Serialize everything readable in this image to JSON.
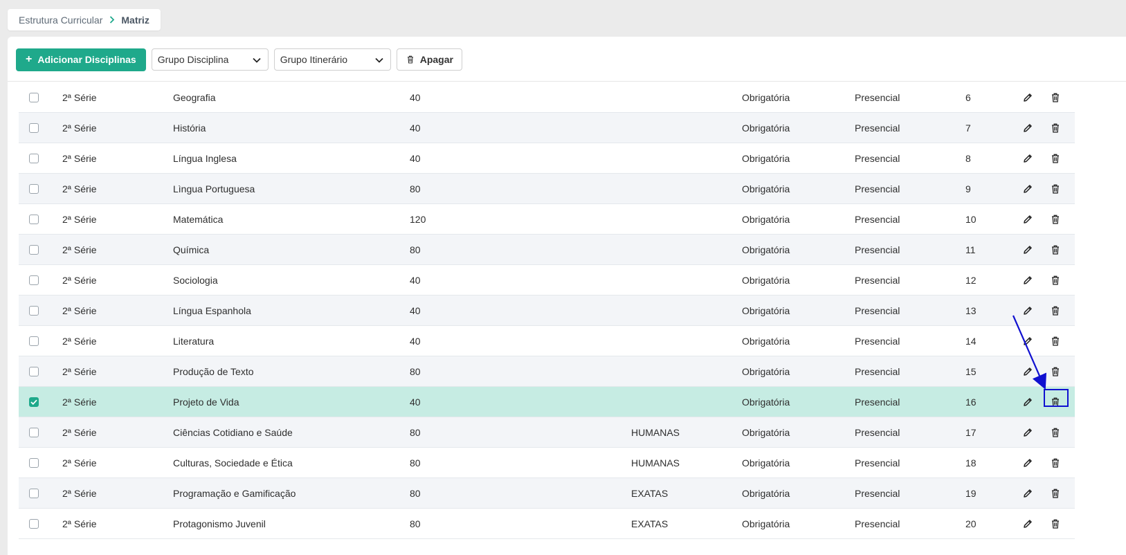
{
  "breadcrumb": {
    "parent": "Estrutura Curricular",
    "current": "Matriz"
  },
  "toolbar": {
    "add_label": "Adicionar Disciplinas",
    "group_discipline": "Grupo Disciplina",
    "group_itinerary": "Grupo Itinerário",
    "delete_label": "Apagar"
  },
  "rows": [
    {
      "serie": "2ª Série",
      "disciplina": "Geografia",
      "ch": "40",
      "grupo": "",
      "tipo": "Obrigatória",
      "modalidade": "Presencial",
      "ordem": "6",
      "checked": false
    },
    {
      "serie": "2ª Série",
      "disciplina": "História",
      "ch": "40",
      "grupo": "",
      "tipo": "Obrigatória",
      "modalidade": "Presencial",
      "ordem": "7",
      "checked": false
    },
    {
      "serie": "2ª Série",
      "disciplina": "Língua Inglesa",
      "ch": "40",
      "grupo": "",
      "tipo": "Obrigatória",
      "modalidade": "Presencial",
      "ordem": "8",
      "checked": false
    },
    {
      "serie": "2ª Série",
      "disciplina": "Lìngua Portuguesa",
      "ch": "80",
      "grupo": "",
      "tipo": "Obrigatória",
      "modalidade": "Presencial",
      "ordem": "9",
      "checked": false
    },
    {
      "serie": "2ª Série",
      "disciplina": "Matemática",
      "ch": "120",
      "grupo": "",
      "tipo": "Obrigatória",
      "modalidade": "Presencial",
      "ordem": "10",
      "checked": false
    },
    {
      "serie": "2ª Série",
      "disciplina": "Química",
      "ch": "80",
      "grupo": "",
      "tipo": "Obrigatória",
      "modalidade": "Presencial",
      "ordem": "11",
      "checked": false
    },
    {
      "serie": "2ª Série",
      "disciplina": "Sociologia",
      "ch": "40",
      "grupo": "",
      "tipo": "Obrigatória",
      "modalidade": "Presencial",
      "ordem": "12",
      "checked": false
    },
    {
      "serie": "2ª Série",
      "disciplina": "Língua Espanhola",
      "ch": "40",
      "grupo": "",
      "tipo": "Obrigatória",
      "modalidade": "Presencial",
      "ordem": "13",
      "checked": false
    },
    {
      "serie": "2ª Série",
      "disciplina": "Literatura",
      "ch": "40",
      "grupo": "",
      "tipo": "Obrigatória",
      "modalidade": "Presencial",
      "ordem": "14",
      "checked": false
    },
    {
      "serie": "2ª Série",
      "disciplina": "Produção de Texto",
      "ch": "80",
      "grupo": "",
      "tipo": "Obrigatória",
      "modalidade": "Presencial",
      "ordem": "15",
      "checked": false
    },
    {
      "serie": "2ª Série",
      "disciplina": "Projeto de Vida",
      "ch": "40",
      "grupo": "",
      "tipo": "Obrigatória",
      "modalidade": "Presencial",
      "ordem": "16",
      "checked": true
    },
    {
      "serie": "2ª Série",
      "disciplina": "Ciências Cotidiano e Saúde",
      "ch": "80",
      "grupo": "HUMANAS",
      "tipo": "Obrigatória",
      "modalidade": "Presencial",
      "ordem": "17",
      "checked": false
    },
    {
      "serie": "2ª Série",
      "disciplina": "Culturas, Sociedade e Ética",
      "ch": "80",
      "grupo": "HUMANAS",
      "tipo": "Obrigatória",
      "modalidade": "Presencial",
      "ordem": "18",
      "checked": false
    },
    {
      "serie": "2ª Série",
      "disciplina": "Programação e Gamificação",
      "ch": "80",
      "grupo": "EXATAS",
      "tipo": "Obrigatória",
      "modalidade": "Presencial",
      "ordem": "19",
      "checked": false
    },
    {
      "serie": "2ª Série",
      "disciplina": "Protagonismo Juvenil",
      "ch": "80",
      "grupo": "EXATAS",
      "tipo": "Obrigatória",
      "modalidade": "Presencial",
      "ordem": "20",
      "checked": false
    }
  ],
  "colors": {
    "accent": "#1fa98b",
    "selected_row": "#c6ece3",
    "annotation": "#1010d0"
  }
}
